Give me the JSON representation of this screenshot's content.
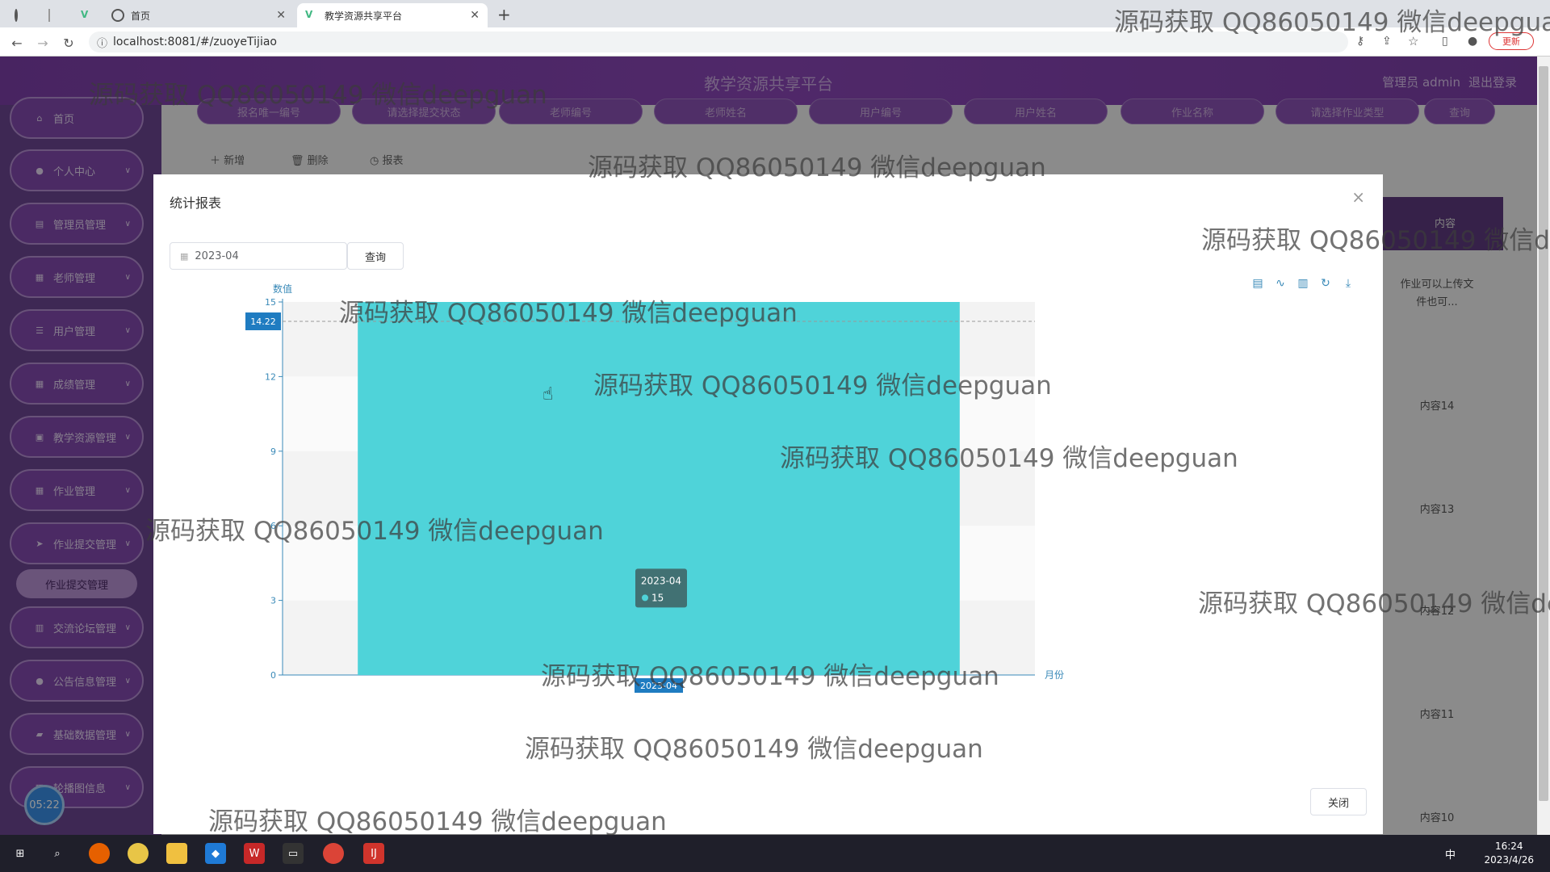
{
  "browser": {
    "tabs": [
      {
        "label": ""
      },
      {
        "label": ""
      },
      {
        "label": ""
      },
      {
        "label": "首页"
      },
      {
        "label": "教学资源共享平台"
      }
    ],
    "url": "localhost:8081/#/zuoyeTijiao",
    "update_label": "更新"
  },
  "header": {
    "title": "教学资源共享平台",
    "user": "管理员 admin",
    "logout": "退出登录"
  },
  "sidebar": {
    "items": [
      {
        "label": "首页",
        "icon": "home-icon"
      },
      {
        "label": "个人中心",
        "icon": "user-icon"
      },
      {
        "label": "管理员管理",
        "icon": "admin-icon"
      },
      {
        "label": "老师管理",
        "icon": "grid-icon"
      },
      {
        "label": "用户管理",
        "icon": "list-icon"
      },
      {
        "label": "成绩管理",
        "icon": "grid-icon"
      },
      {
        "label": "教学资源管理",
        "icon": "resource-icon"
      },
      {
        "label": "作业管理",
        "icon": "grid-icon"
      },
      {
        "label": "作业提交管理",
        "icon": "send-icon"
      },
      {
        "label": "交流论坛管理",
        "icon": "chart-icon"
      },
      {
        "label": "公告信息管理",
        "icon": "pin-icon"
      },
      {
        "label": "基础数据管理",
        "icon": "stack-icon"
      },
      {
        "label": "轮播图信息",
        "icon": "image-icon"
      }
    ],
    "submenu": "作业提交管理",
    "clock": "05:22"
  },
  "search": {
    "fields": [
      "报名唯一编号",
      "请选择提交状态",
      "老师编号",
      "老师姓名",
      "用户编号",
      "用户姓名",
      "作业名称",
      "请选择作业类型"
    ],
    "query_label": "查询"
  },
  "actions": {
    "add": "新增",
    "delete": "删除",
    "report": "报表"
  },
  "table_right": {
    "header": "内容",
    "cells": [
      "作业可以上传文件也可...",
      "内容14",
      "内容13",
      "内容12",
      "内容11",
      "内容10"
    ]
  },
  "dialog": {
    "title": "统计报表",
    "date_value": "2023-04",
    "query_label": "查询",
    "close_label": "关闭",
    "toolbox": [
      "data-view-icon",
      "line-icon",
      "bar-icon",
      "refresh-icon",
      "download-icon"
    ]
  },
  "chart_data": {
    "type": "bar",
    "categories": [
      "2023-04"
    ],
    "values": [
      15
    ],
    "ylabel": "数值",
    "xlabel": "月份",
    "ylim": [
      0,
      15
    ],
    "yticks": [
      0,
      3,
      6,
      9,
      12,
      15
    ],
    "cursor_y": "14.22",
    "tooltip": {
      "title": "2023-04",
      "value": "15"
    },
    "bar_color": "#4fd3d9"
  },
  "taskbar": {
    "time": "16:24",
    "date": "2023/4/26",
    "ime": "中"
  },
  "watermark": "源码获取 QQ86050149 微信deepguan"
}
